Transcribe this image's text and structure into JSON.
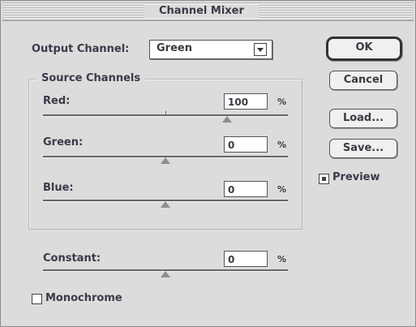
{
  "window": {
    "title": "Channel Mixer"
  },
  "output": {
    "label": "Output Channel:",
    "value": "Green"
  },
  "source": {
    "title": "Source Channels",
    "channels": [
      {
        "label": "Red:",
        "value": "100",
        "unit": "%",
        "fraction": 0.75
      },
      {
        "label": "Green:",
        "value": "0",
        "unit": "%",
        "fraction": 0.5
      },
      {
        "label": "Blue:",
        "value": "0",
        "unit": "%",
        "fraction": 0.5
      }
    ]
  },
  "constant": {
    "label": "Constant:",
    "value": "0",
    "unit": "%",
    "fraction": 0.5
  },
  "monochrome": {
    "label": "Monochrome",
    "checked": false
  },
  "buttons": {
    "ok": "OK",
    "cancel": "Cancel",
    "load": "Load...",
    "save": "Save..."
  },
  "preview": {
    "label": "Preview",
    "checked": true
  }
}
